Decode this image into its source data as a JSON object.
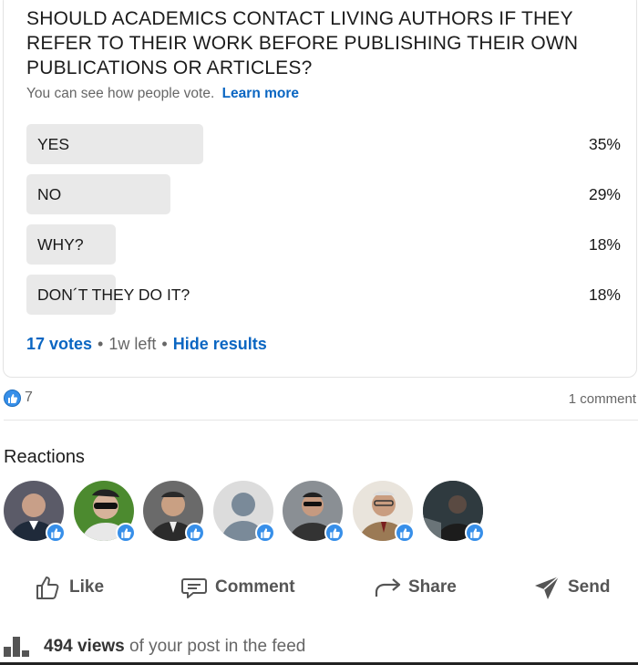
{
  "poll": {
    "question": "SHOULD ACADEMICS CONTACT LIVING AUTHORS IF THEY REFER TO THEIR WORK BEFORE PUBLISHING THEIR OWN PUBLICATIONS OR ARTICLES?",
    "subtitle": "You can see how people vote.",
    "learn_more": "Learn more",
    "options": [
      {
        "label": "YES",
        "percent": "35%",
        "fraction": 0.35
      },
      {
        "label": "NO",
        "percent": "29%",
        "fraction": 0.29
      },
      {
        "label": "WHY?",
        "percent": "18%",
        "fraction": 0.18
      },
      {
        "label": "DON´T THEY DO IT?",
        "percent": "18%",
        "fraction": 0.18
      }
    ],
    "votes": "17 votes",
    "time_left": "1w left",
    "hide_results": "Hide results"
  },
  "social": {
    "like_count": "7",
    "comment_count": "1 comment"
  },
  "reactions": {
    "title": "Reactions",
    "avatars": [
      {
        "name": "avatar-1",
        "bg": "#5b5b68"
      },
      {
        "name": "avatar-2",
        "bg": "#4c8a2f"
      },
      {
        "name": "avatar-3",
        "bg": "#6a6a6a"
      },
      {
        "name": "avatar-4",
        "bg": "#dcdcdc"
      },
      {
        "name": "avatar-5",
        "bg": "#8a8f94"
      },
      {
        "name": "avatar-6",
        "bg": "#b9a58c"
      },
      {
        "name": "avatar-7",
        "bg": "#3f4a4f"
      }
    ]
  },
  "actions": {
    "like": "Like",
    "comment": "Comment",
    "share": "Share",
    "send": "Send"
  },
  "views": {
    "count": "494 views",
    "suffix": "of your post in the feed"
  },
  "colors": {
    "accent": "#0a66c2",
    "bar": "#e9e9e9",
    "like_blue": "#378fe9"
  }
}
